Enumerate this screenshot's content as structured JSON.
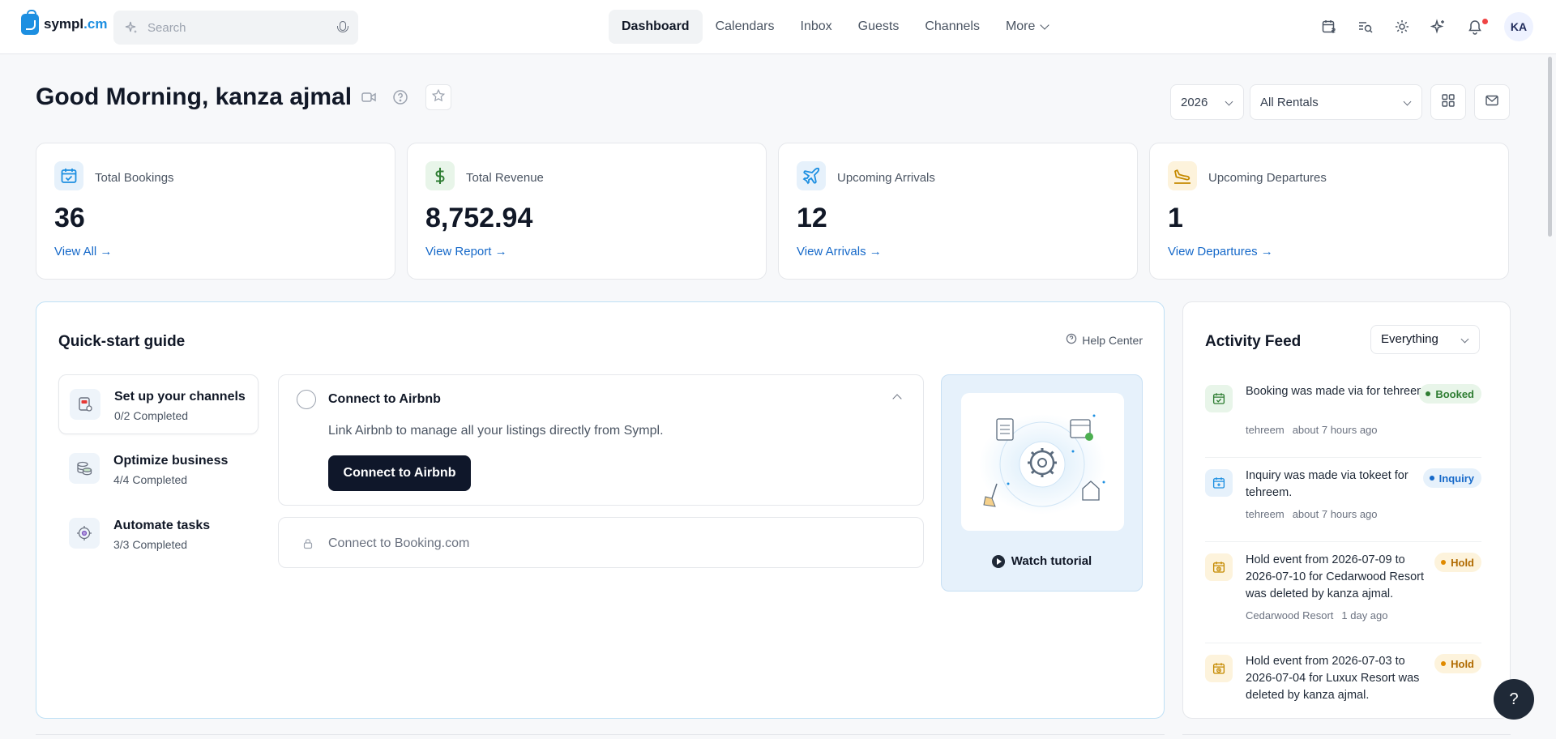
{
  "brand": {
    "name_main": "sympl",
    "name_dot": ".cm"
  },
  "search": {
    "placeholder": "Search"
  },
  "nav": {
    "items": [
      "Dashboard",
      "Calendars",
      "Inbox",
      "Guests",
      "Channels",
      "More"
    ],
    "active": "Dashboard"
  },
  "user": {
    "initials": "KA"
  },
  "header": {
    "greeting": "Good Morning, kanza ajmal",
    "year": "2026",
    "rentals": "All Rentals"
  },
  "stats": [
    {
      "label": "Total Bookings",
      "value": "36",
      "link": "View All →",
      "icon": "calendar-check-icon",
      "color": "#1d8fe1",
      "bg": "#e6f1fb"
    },
    {
      "label": "Total Revenue",
      "value": "8,752.94",
      "link": "View Report →",
      "icon": "dollar-icon",
      "color": "#2e7d32",
      "bg": "#e8f5e9"
    },
    {
      "label": "Upcoming Arrivals",
      "value": "12",
      "link": "View Arrivals →",
      "icon": "plane-icon",
      "color": "#1d8fe1",
      "bg": "#e6f1fb"
    },
    {
      "label": "Upcoming Departures",
      "value": "1",
      "link": "View Departures →",
      "icon": "plane-landing-icon",
      "color": "#c58a00",
      "bg": "#fdf3dc"
    }
  ],
  "quickstart": {
    "title": "Quick-start guide",
    "help_center": "Help Center",
    "steps": [
      {
        "title": "Set up your channels",
        "sub": "0/2 Completed"
      },
      {
        "title": "Optimize business",
        "sub": "4/4 Completed"
      },
      {
        "title": "Automate tasks",
        "sub": "3/3 Completed"
      }
    ],
    "task1": {
      "title": "Connect to Airbnb",
      "desc": "Link Airbnb to manage all your listings directly from Sympl.",
      "button": "Connect to Airbnb"
    },
    "task2": {
      "title": "Connect to Booking.com"
    },
    "tutorial": "Watch tutorial"
  },
  "feed": {
    "title": "Activity Feed",
    "filter": "Everything",
    "items": [
      {
        "text": "Booking was made via for tehreem.",
        "who": "tehreem",
        "when": "about 7 hours ago",
        "badge": "Booked",
        "kind": "green",
        "icon": "calendar-check-icon"
      },
      {
        "text": "Inquiry was made via tokeet for tehreem.",
        "who": "tehreem",
        "when": "about 7 hours ago",
        "badge": "Inquiry",
        "kind": "blue",
        "icon": "calendar-plus-icon"
      },
      {
        "text": "Hold event from 2026-07-09 to 2026-07-10 for Cedarwood Resort was deleted by kanza ajmal.",
        "who": "Cedarwood Resort",
        "when": "1 day ago",
        "badge": "Hold",
        "kind": "orange",
        "icon": "calendar-clock-icon"
      },
      {
        "text": "Hold event from 2026-07-03 to 2026-07-04 for Luxux Resort was deleted by kanza ajmal.",
        "who": "",
        "when": "",
        "badge": "Hold",
        "kind": "orange",
        "icon": "calendar-clock-icon"
      }
    ]
  },
  "help_fab": "?"
}
